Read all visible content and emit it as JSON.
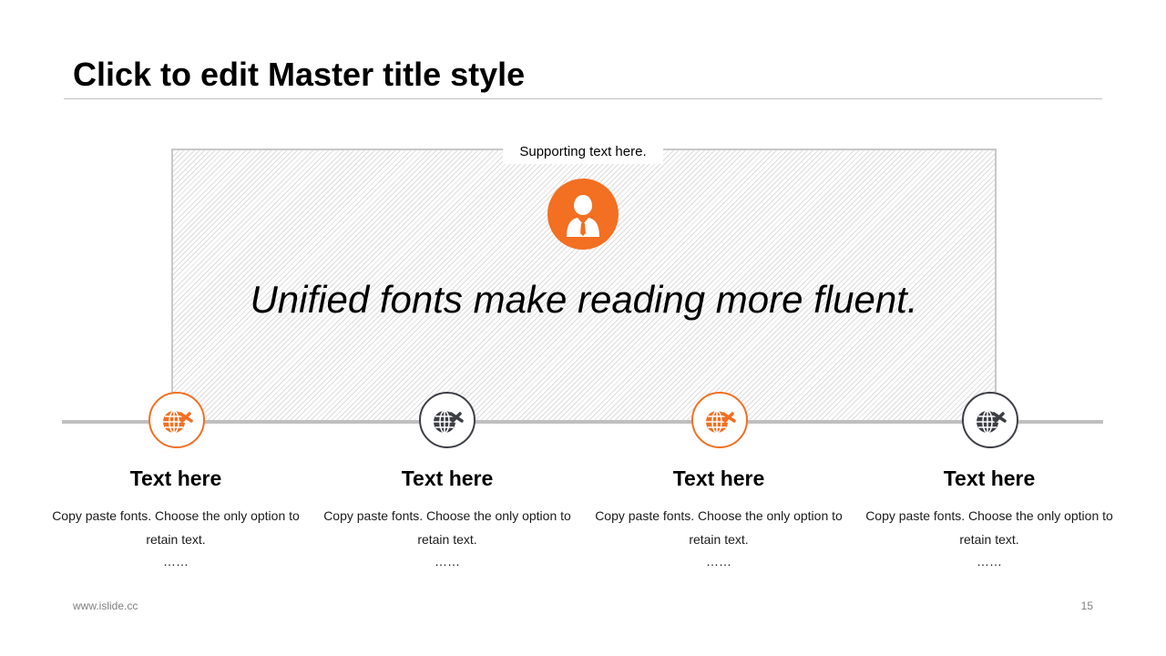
{
  "slide": {
    "title": "Click to edit Master title style",
    "supporting_text": "Supporting text here.",
    "quote": "Unified fonts make reading more fluent.",
    "center_icon": "person-icon"
  },
  "timeline": {
    "items": [
      {
        "title": "Text here",
        "body": "Copy paste fonts. Choose the only option to retain text.",
        "dots": "……",
        "icon": "globe-plane-icon",
        "accent": "#f36f21"
      },
      {
        "title": "Text here",
        "body": "Copy paste fonts. Choose the only option to retain text.",
        "dots": "……",
        "icon": "globe-plane-icon",
        "accent": "#3d3f45"
      },
      {
        "title": "Text here",
        "body": "Copy paste fonts. Choose the only option to retain text.",
        "dots": "……",
        "icon": "globe-plane-icon",
        "accent": "#f36f21"
      },
      {
        "title": "Text here",
        "body": "Copy paste fonts. Choose the only option to retain text.",
        "dots": "……",
        "icon": "globe-plane-icon",
        "accent": "#3d3f45"
      }
    ]
  },
  "footer": {
    "url": "www.islide.cc",
    "page_number": "15"
  },
  "colors": {
    "accent_orange": "#f36f21",
    "accent_dark": "#3d3f45",
    "rule_gray": "#bfbfbf"
  }
}
